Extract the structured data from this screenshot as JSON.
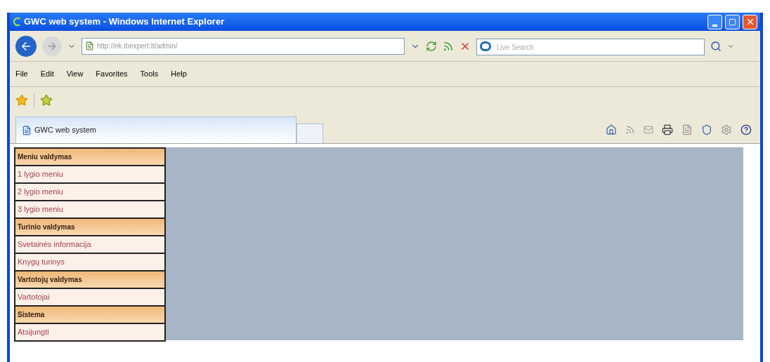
{
  "window": {
    "title": "GWC web system - Windows Internet Explorer"
  },
  "address_bar": {
    "value": "http://ek.ibexpert.lt/admin/"
  },
  "search": {
    "placeholder": "Live Search"
  },
  "menu_bar": [
    "File",
    "Edit",
    "View",
    "Favorites",
    "Tools",
    "Help"
  ],
  "tabs": [
    {
      "label": "GWC web system",
      "selected": true
    }
  ],
  "sidebar": {
    "items": [
      {
        "kind": "header",
        "label": "Meniu valdymas"
      },
      {
        "kind": "link",
        "label": "1 lygio meniu"
      },
      {
        "kind": "link",
        "label": "2 lygio meniu"
      },
      {
        "kind": "link",
        "label": "3 lygio meniu"
      },
      {
        "kind": "header",
        "label": "Turinio valdymas"
      },
      {
        "kind": "link",
        "label": "Svetainės informacija"
      },
      {
        "kind": "link",
        "label": "Knygų turinys"
      },
      {
        "kind": "header",
        "label": "Vartotojų valdymas"
      },
      {
        "kind": "link",
        "label": "Vartotojai"
      },
      {
        "kind": "header",
        "label": "Sistema"
      },
      {
        "kind": "link",
        "label": "Atsijungti"
      }
    ]
  }
}
